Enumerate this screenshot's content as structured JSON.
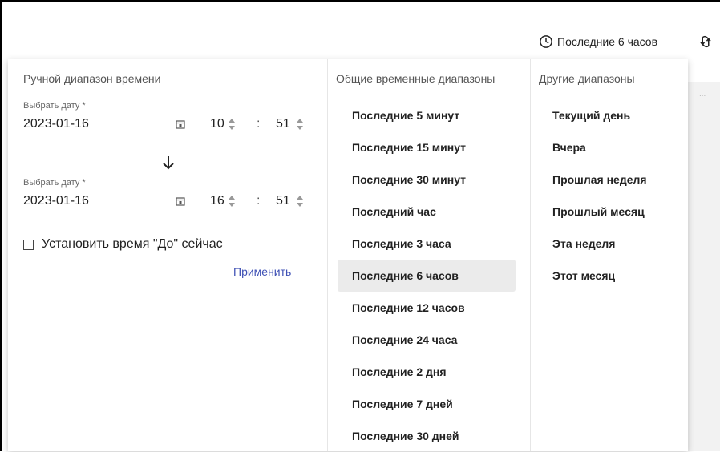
{
  "toolbar": {
    "time_range_label": "Последние 6 часов",
    "clock_icon": "clock-icon",
    "refresh_icon": "refresh-icon"
  },
  "background": {
    "dots": "..."
  },
  "manual_range": {
    "title": "Ручной диапазон времени",
    "from": {
      "label": "Выбрать дату *",
      "date": "2023-01-16",
      "hour": "10",
      "minute": "51"
    },
    "to": {
      "label": "Выбрать дату *",
      "date": "2023-01-16",
      "hour": "16",
      "minute": "51"
    },
    "colon": ":",
    "set_now_label": "Установить время \"До\" сейчас",
    "set_now_checked": false,
    "apply_label": "Применить"
  },
  "common_ranges": {
    "title": "Общие временные диапазоны",
    "items": [
      "Последние 5 минут",
      "Последние 15 минут",
      "Последние 30 минут",
      "Последний час",
      "Последние 3 часа",
      "Последние 6 часов",
      "Последние 12 часов",
      "Последние 24 часа",
      "Последние 2 дня",
      "Последние 7 дней",
      "Последние 30 дней"
    ],
    "selected": "Последние 6 часов"
  },
  "other_ranges": {
    "title": "Другие диапазоны",
    "items": [
      "Текущий день",
      "Вчера",
      "Прошлая неделя",
      "Прошлый месяц",
      "Эта неделя",
      "Этот месяц"
    ]
  },
  "colors": {
    "accent": "#3f51b5",
    "selected_bg": "#ebebeb"
  }
}
